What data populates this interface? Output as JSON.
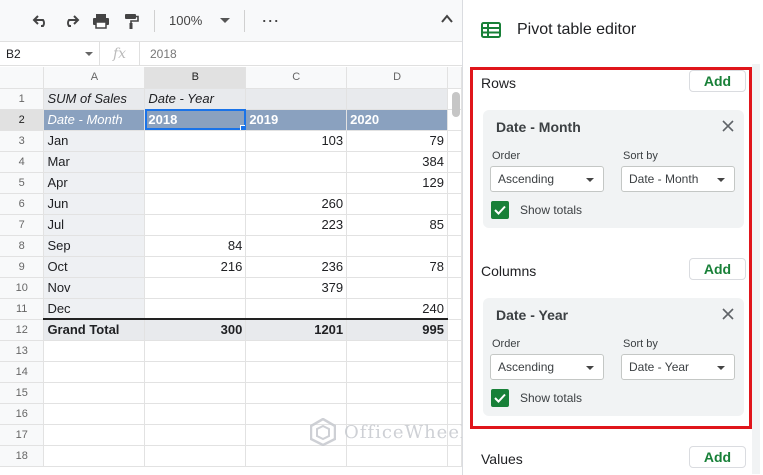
{
  "toolbar": {
    "zoom": "100%",
    "more": "⋯"
  },
  "formula_bar": {
    "cell_ref": "B2",
    "fx": "fx",
    "value": "2018"
  },
  "grid": {
    "columns": [
      "A",
      "B",
      "C",
      "D"
    ],
    "row_numbers": [
      "1",
      "2",
      "3",
      "4",
      "5",
      "6",
      "7",
      "8",
      "9",
      "10",
      "11",
      "12",
      "13",
      "14",
      "15",
      "16",
      "17",
      "18"
    ],
    "pivot_title": "SUM of Sales",
    "pivot_col_field": "Date - Year",
    "pivot_row_field": "Date - Month",
    "years": [
      "2018",
      "2019",
      "2020"
    ],
    "rows": [
      {
        "label": "Jan",
        "v2018": "",
        "v2019": "103",
        "v2020": "79"
      },
      {
        "label": "Mar",
        "v2018": "",
        "v2019": "",
        "v2020": "384"
      },
      {
        "label": "Apr",
        "v2018": "",
        "v2019": "",
        "v2020": "129"
      },
      {
        "label": "Jun",
        "v2018": "",
        "v2019": "260",
        "v2020": ""
      },
      {
        "label": "Jul",
        "v2018": "",
        "v2019": "223",
        "v2020": "85"
      },
      {
        "label": "Sep",
        "v2018": "84",
        "v2019": "",
        "v2020": ""
      },
      {
        "label": "Oct",
        "v2018": "216",
        "v2019": "236",
        "v2020": "78"
      },
      {
        "label": "Nov",
        "v2018": "",
        "v2019": "379",
        "v2020": ""
      },
      {
        "label": "Dec",
        "v2018": "",
        "v2019": "",
        "v2020": "240"
      }
    ],
    "grand_total": {
      "label": "Grand Total",
      "v2018": "300",
      "v2019": "1201",
      "v2020": "995"
    }
  },
  "watermark": "OfficeWheel",
  "panel": {
    "title": "Pivot table editor",
    "rows_section": {
      "title": "Rows",
      "add_label": "Add",
      "card": {
        "field": "Date - Month",
        "order_label": "Order",
        "order_value": "Ascending",
        "sortby_label": "Sort by",
        "sortby_value": "Date - Month",
        "show_totals": "Show totals"
      }
    },
    "columns_section": {
      "title": "Columns",
      "add_label": "Add",
      "card": {
        "field": "Date - Year",
        "order_label": "Order",
        "order_value": "Ascending",
        "sortby_label": "Sort by",
        "sortby_value": "Date - Year",
        "show_totals": "Show totals"
      }
    },
    "values_section": {
      "title": "Values",
      "add_label": "Add"
    }
  },
  "colors": {
    "accent_green": "#188038",
    "pivot_header": "#8aa1bf",
    "highlight_red": "#e0151b",
    "selection_blue": "#1a73e8"
  }
}
